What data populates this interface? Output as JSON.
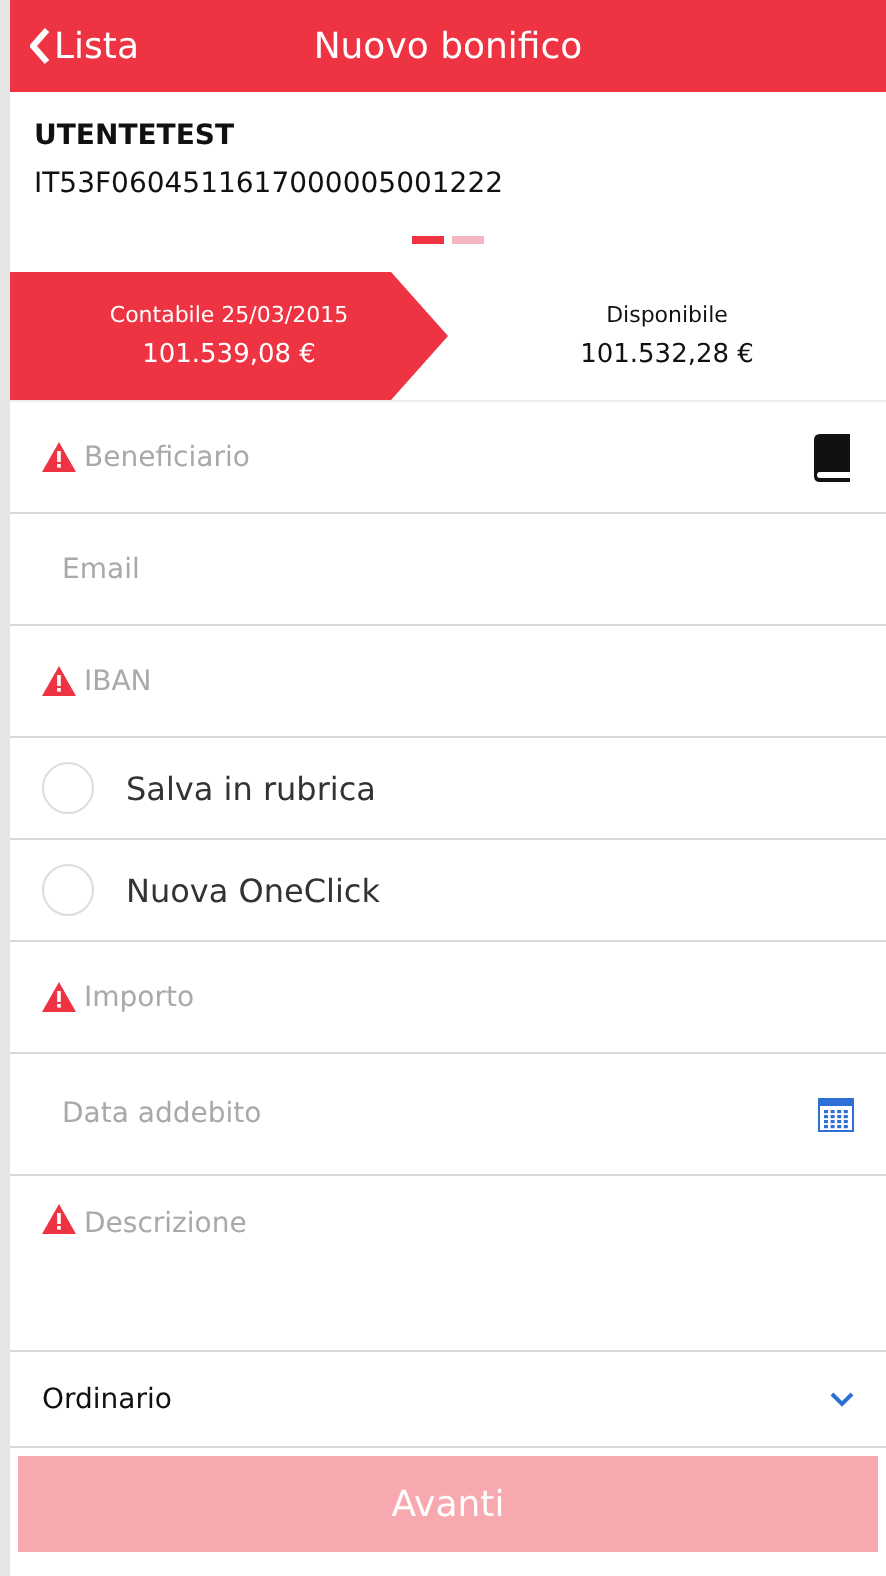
{
  "header": {
    "back": "Lista",
    "title": "Nuovo bonifico"
  },
  "account": {
    "holder": "UTENTETEST",
    "iban": "IT53F0604511617000005001222"
  },
  "pager": [
    {
      "selected": true
    },
    {
      "selected": false
    }
  ],
  "balances": [
    {
      "label": "Contabile 25/03/2015",
      "amount": "101.539,08 €",
      "selected": true
    },
    {
      "label": "Disponibile",
      "amount": "101.532,28 €",
      "selected": false
    }
  ],
  "form": [
    {
      "kind": "contacts",
      "placeholder": "Beneficiario",
      "required": true
    },
    {
      "kind": "text",
      "placeholder": "Email",
      "required": false
    },
    {
      "kind": "text",
      "placeholder": "IBAN",
      "required": true
    },
    {
      "kind": "check",
      "label": "Salva in rubrica",
      "checked": false
    },
    {
      "kind": "check",
      "label": "Nuova OneClick",
      "checked": false
    },
    {
      "kind": "text",
      "placeholder": "Importo",
      "required": true
    },
    {
      "kind": "date",
      "placeholder": "Data addebito",
      "required": false
    },
    {
      "kind": "textarea",
      "placeholder": "Descrizione",
      "required": true
    },
    {
      "kind": "select",
      "value": "Ordinario"
    }
  ],
  "submit": {
    "label": "Avanti",
    "disabled": true
  }
}
